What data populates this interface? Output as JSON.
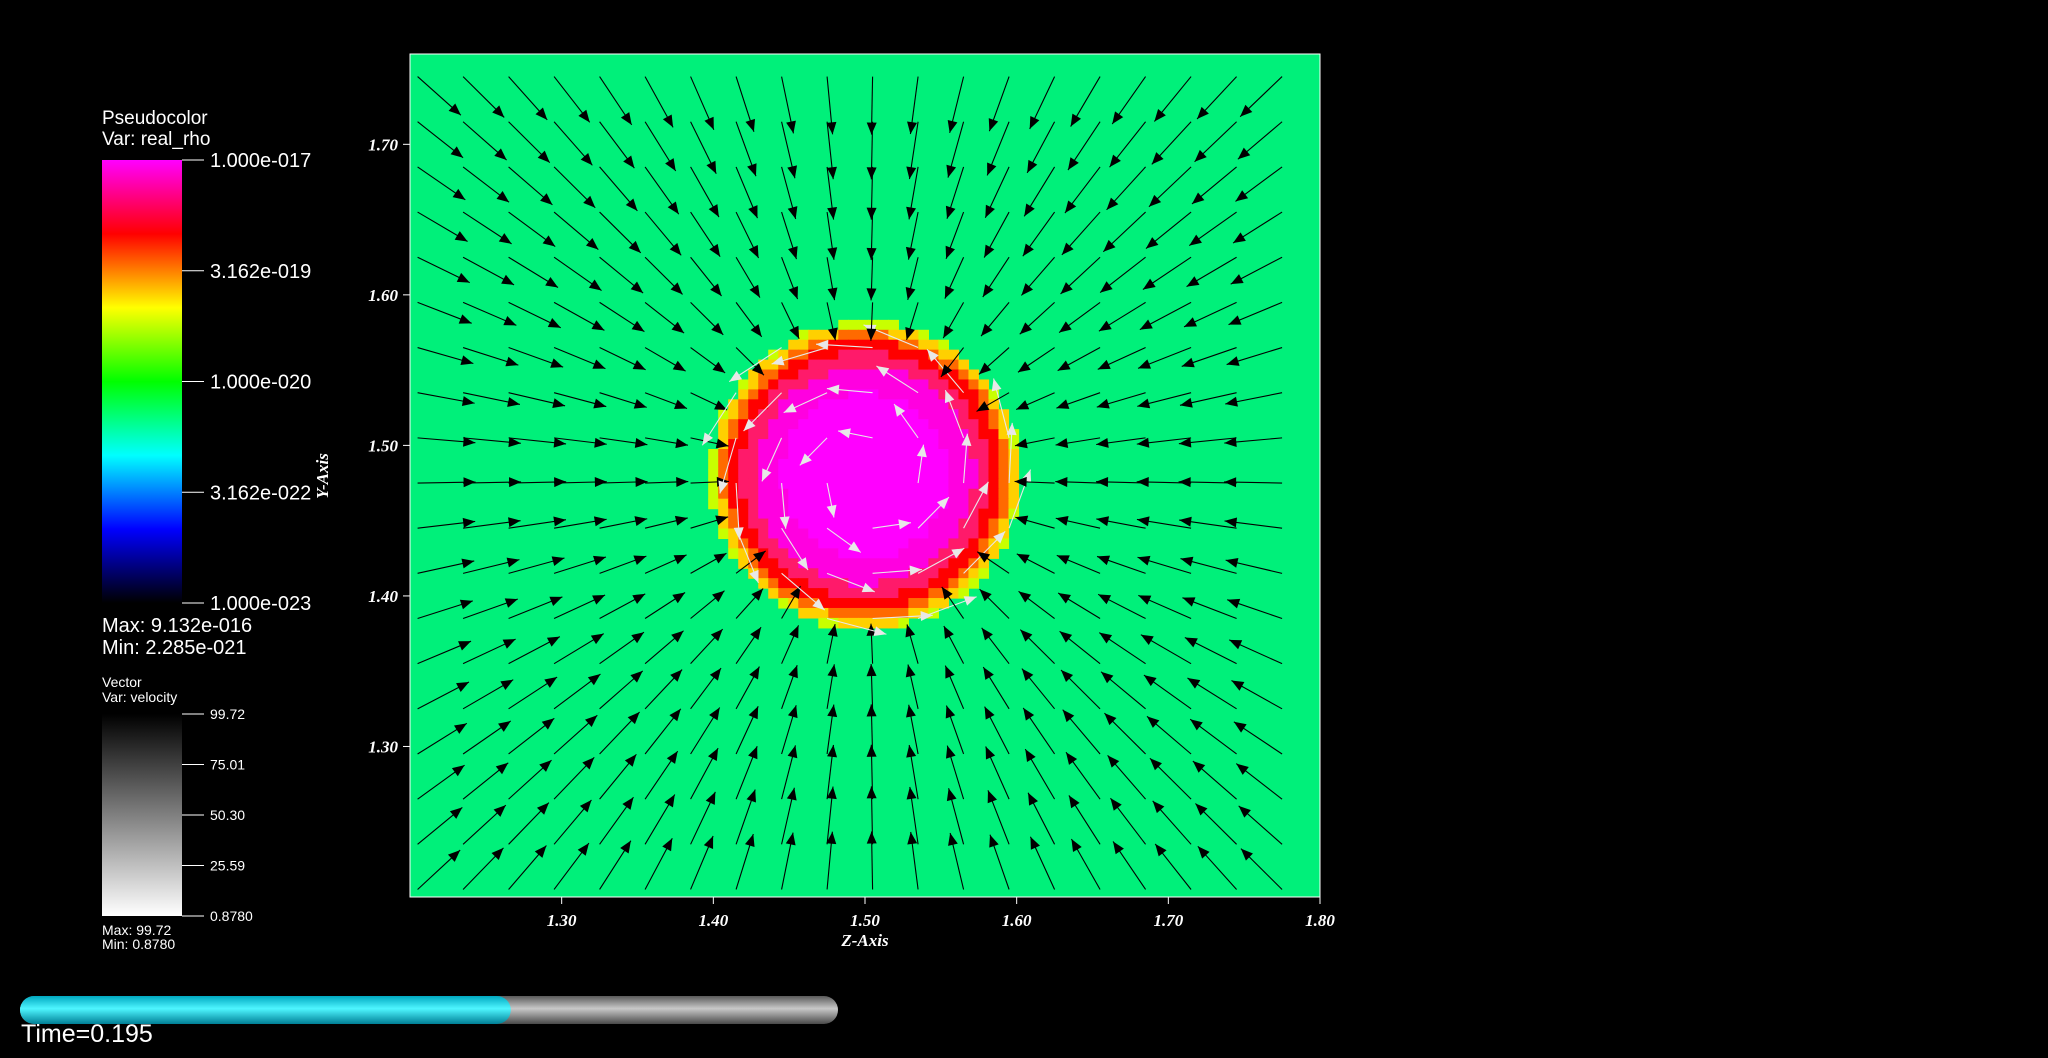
{
  "chart_data": {
    "type": "heatmap",
    "title": "",
    "xlabel": "Z-Axis",
    "ylabel": "Y-Axis",
    "xlim": [
      1.2,
      1.8
    ],
    "ylim": [
      1.2,
      1.76
    ],
    "x_ticks": [
      "1.30",
      "1.40",
      "1.50",
      "1.60",
      "1.70",
      "1.80"
    ],
    "x_tick_values": [
      1.3,
      1.4,
      1.5,
      1.6,
      1.7,
      1.8
    ],
    "y_ticks": [
      "1.30",
      "1.40",
      "1.50",
      "1.60",
      "1.70"
    ],
    "y_tick_values": [
      1.3,
      1.4,
      1.5,
      1.6,
      1.7
    ],
    "field": {
      "center_z": 1.5,
      "center_y": 1.48,
      "blob_radius": 0.1,
      "background_color": "#00f07a"
    },
    "pseudocolor_legend": {
      "title": "Pseudocolor",
      "var": "Var: real_rho",
      "scale": "log",
      "ticks": [
        "1.000e-017",
        "3.162e-019",
        "1.000e-020",
        "3.162e-022",
        "1.000e-023"
      ],
      "max_label": "Max:  9.132e-016",
      "min_label": "Min:  2.285e-021",
      "gradient_colors": [
        "#ff00ff",
        "#ff0000",
        "#ffff00",
        "#00ff00",
        "#00ffff",
        "#0000ff",
        "#000000"
      ]
    },
    "vector_legend": {
      "title": "Vector",
      "var": "Var: velocity",
      "ticks": [
        "99.72",
        "75.01",
        "50.30",
        "25.59",
        "0.8780"
      ],
      "max_label": "Max: 99.72",
      "min_label": "Min: 0.8780",
      "gradient_colors": [
        "#000000",
        "#ffffff"
      ]
    }
  },
  "time_slider": {
    "progress": 0.6,
    "fill_color": "#00e5ff"
  },
  "time_label": "Time=0.195"
}
